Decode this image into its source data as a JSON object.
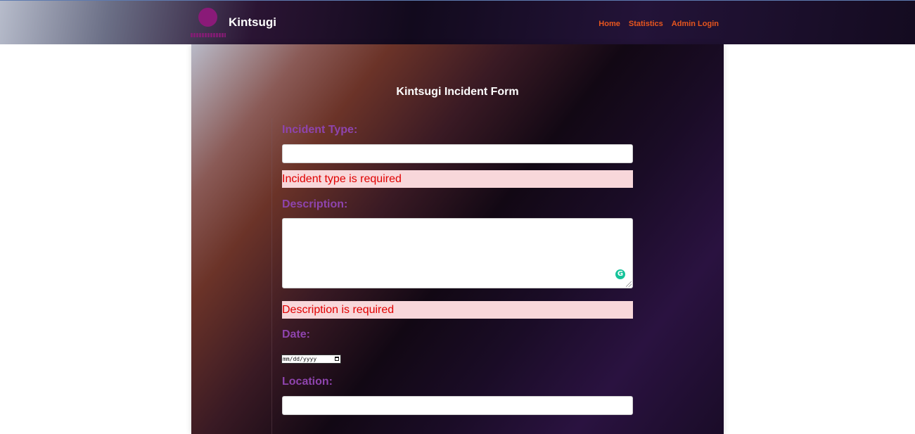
{
  "navbar": {
    "brand": "Kintsugi",
    "links": [
      "Home",
      "Statistics",
      "Admin Login"
    ]
  },
  "form": {
    "title": "Kintsugi Incident Form",
    "incident_type_label": "Incident Type:",
    "incident_type_value": "",
    "incident_type_error": "Incident type is required",
    "description_label": "Description:",
    "description_value": "",
    "description_error": "Description is required",
    "date_label": "Date:",
    "date_placeholder": "mm/dd/yyyy",
    "location_label": "Location:",
    "location_value": ""
  },
  "colors": {
    "nav_link": "#e8561e",
    "label": "#8e44ad",
    "error_text": "#e00000",
    "error_bg": "#f8d7da"
  },
  "icons": [
    "logo-icon",
    "grammarly-icon",
    "calendar-icon"
  ]
}
